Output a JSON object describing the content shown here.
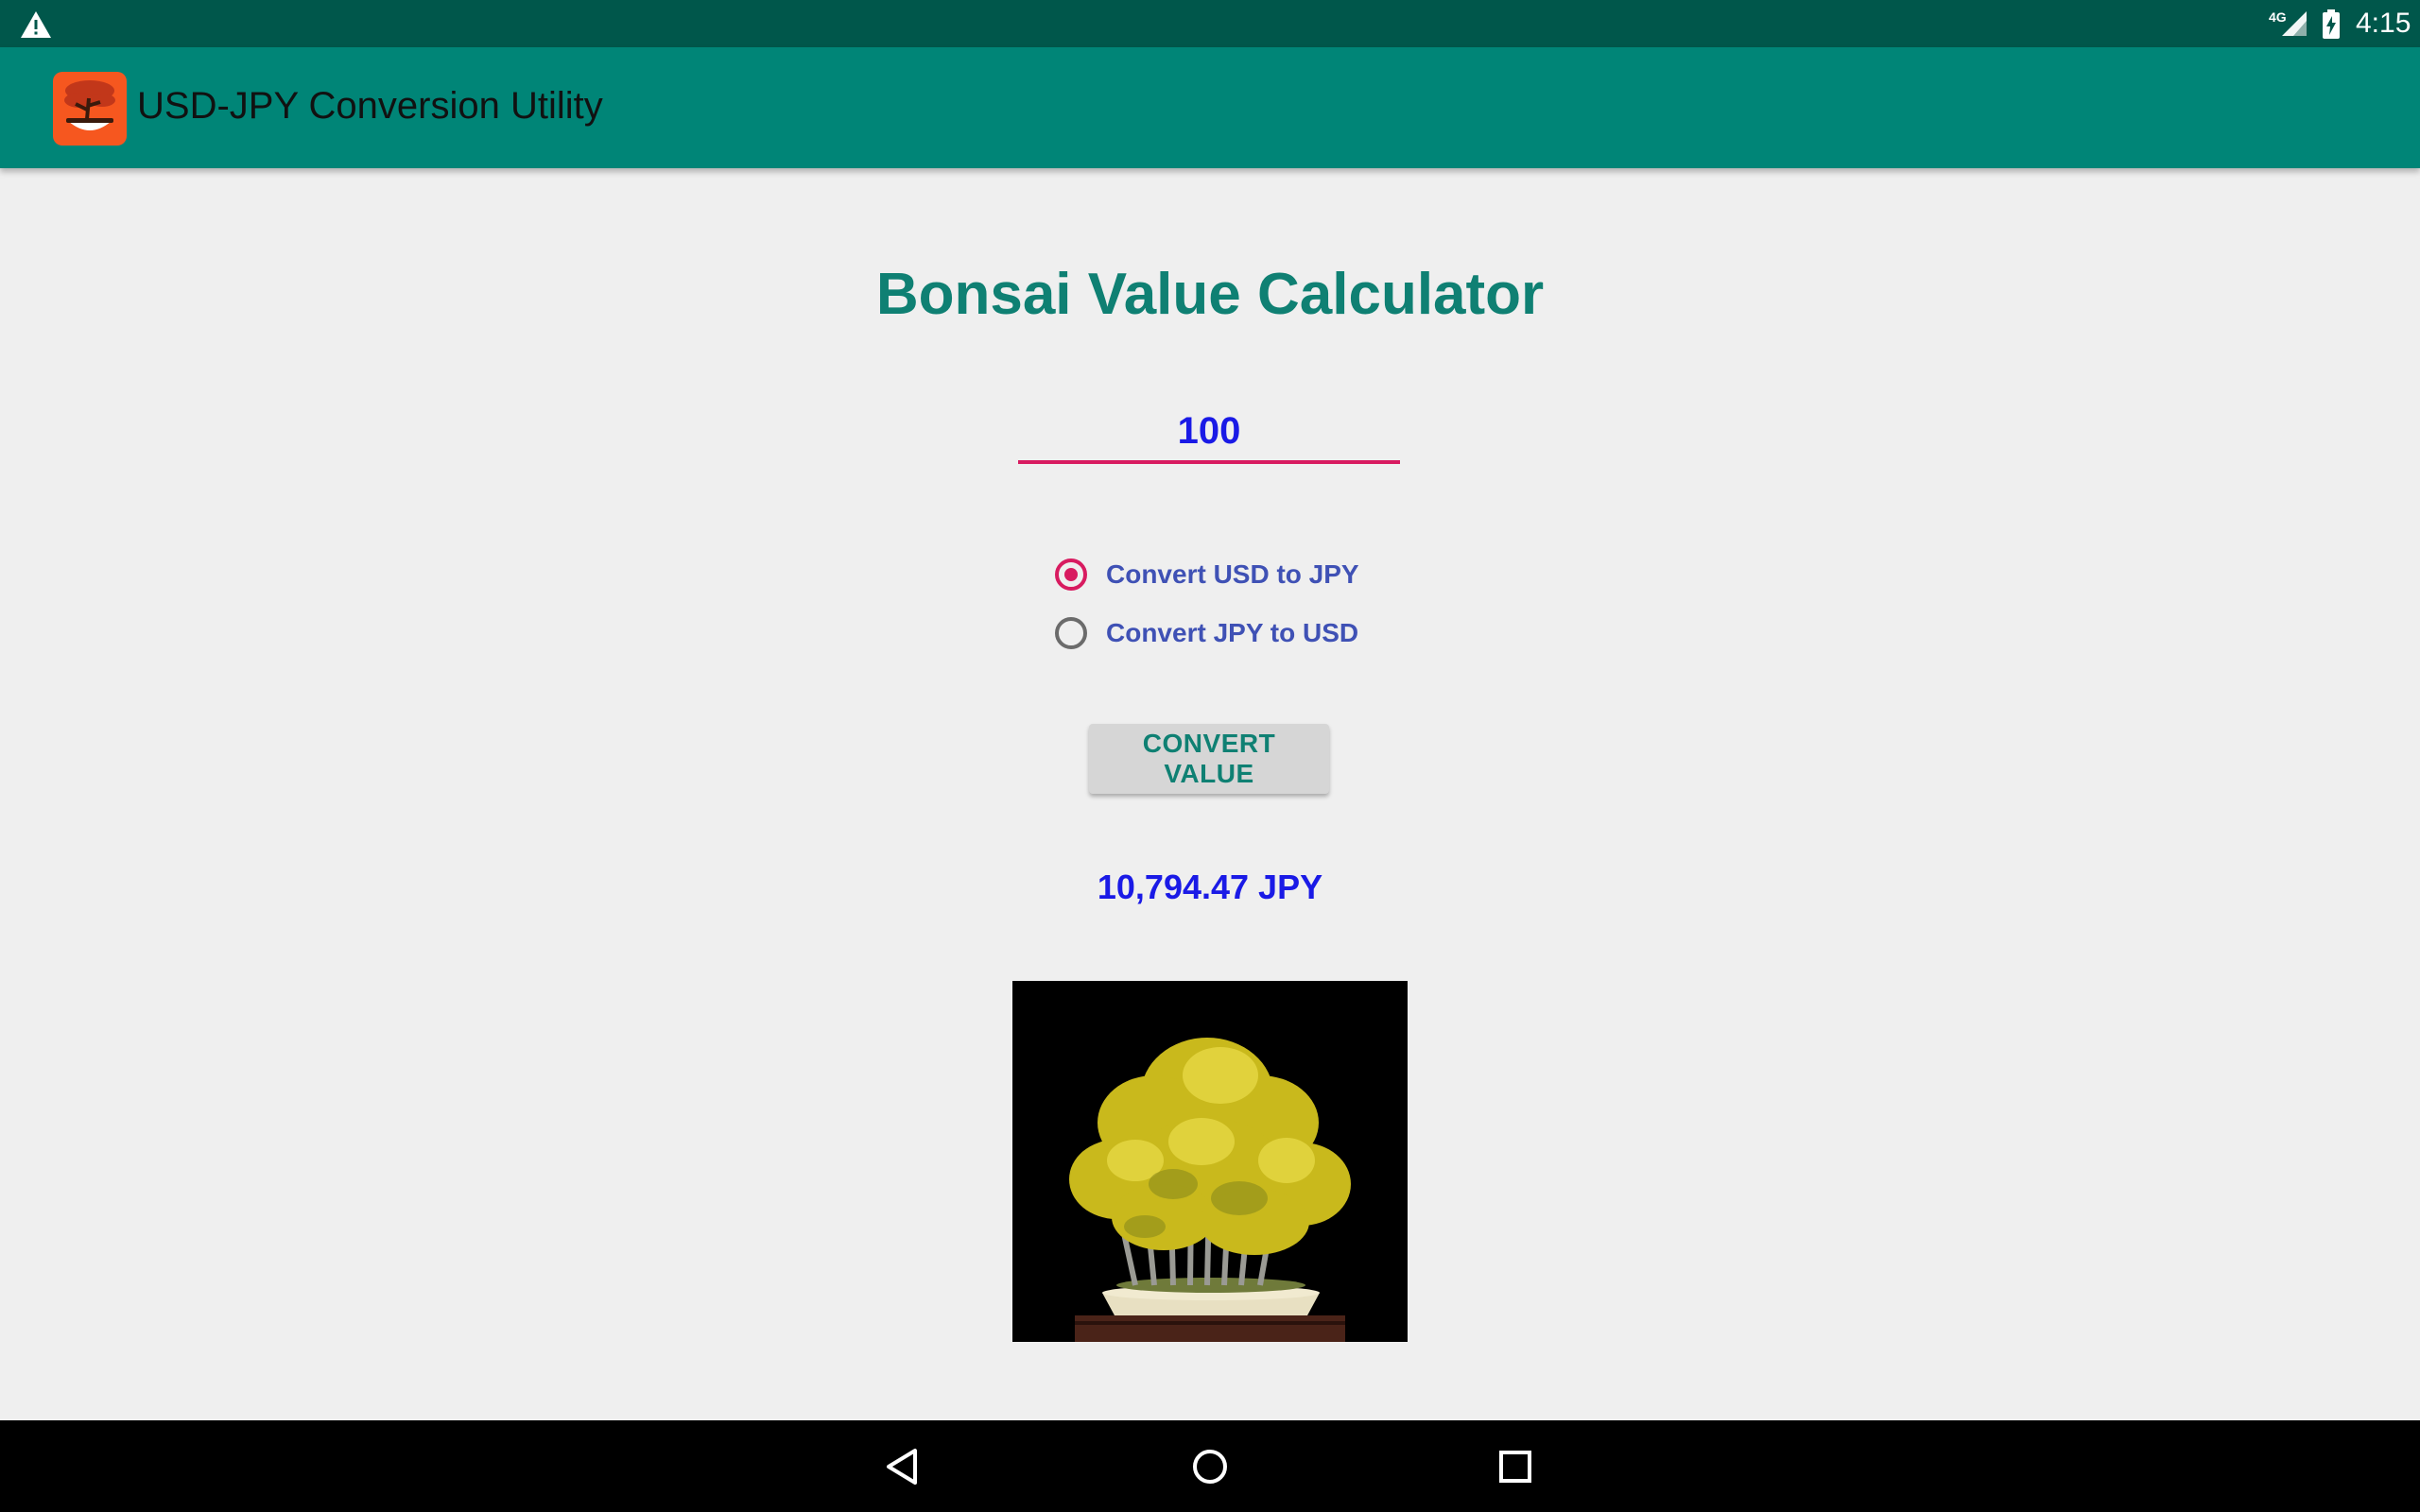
{
  "status_bar": {
    "network": "4G",
    "time": "4:15",
    "icons": [
      "warning-icon",
      "signal-icon",
      "battery-charging-icon"
    ]
  },
  "app_bar": {
    "title": "USD-JPY Conversion Utility",
    "logo": "bonsai-logo-icon"
  },
  "main": {
    "heading": "Bonsai Value Calculator",
    "amount_input": {
      "value": "100",
      "placeholder": ""
    },
    "radio_options": [
      {
        "label": "Convert USD to JPY",
        "checked": true
      },
      {
        "label": "Convert JPY to USD",
        "checked": false
      }
    ],
    "convert_button": "CONVERT VALUE",
    "result": "10,794.47 JPY",
    "image": "bonsai-tree-photo"
  },
  "nav_bar": {
    "buttons": [
      "back-icon",
      "home-icon",
      "recents-icon"
    ]
  },
  "colors": {
    "status_bar": "#00574b",
    "app_bar": "#008577",
    "accent": "#d81b60",
    "heading": "#0f8073",
    "radio_label": "#3f51b5",
    "result": "#1a1ae6",
    "background": "#efefef"
  }
}
